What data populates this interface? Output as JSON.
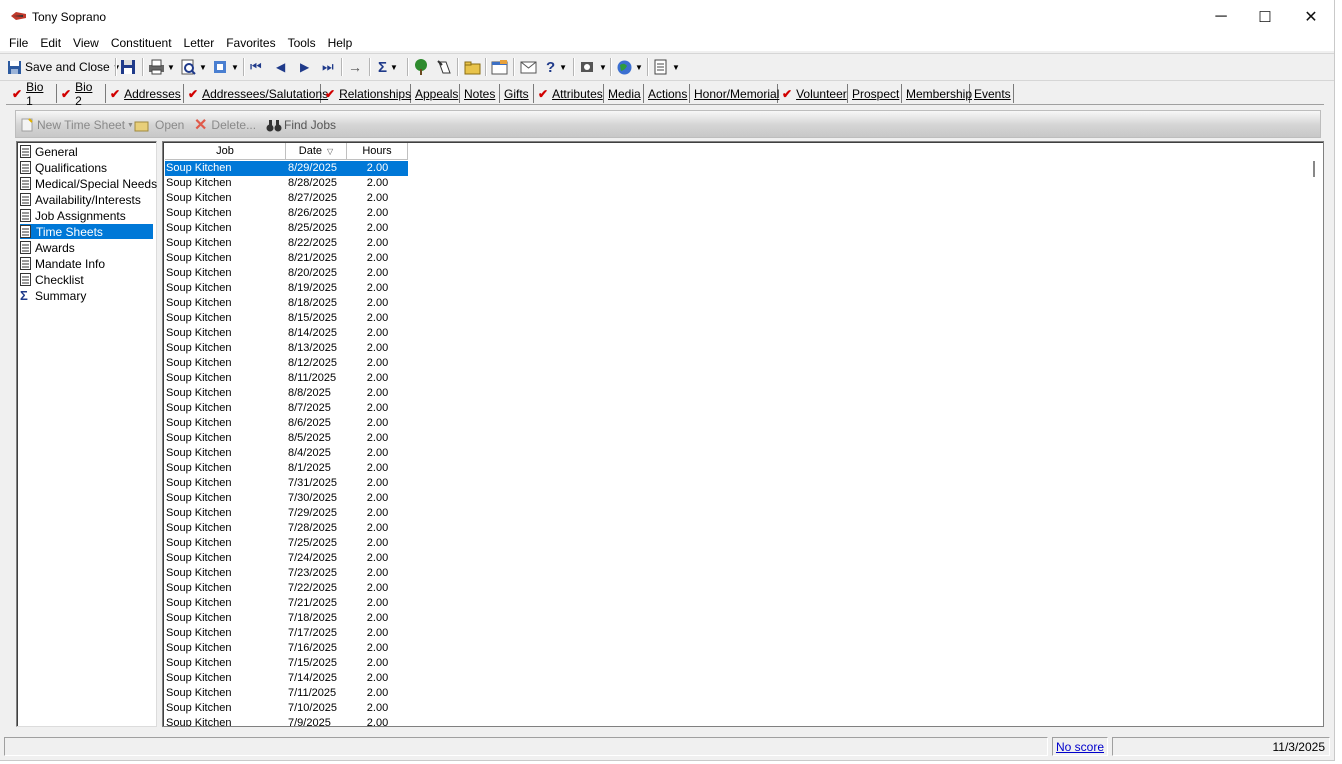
{
  "window": {
    "title": "Tony Soprano",
    "minimize": "─",
    "maximize": "☐",
    "close": "✕"
  },
  "menu": [
    "File",
    "Edit",
    "View",
    "Constituent",
    "Letter",
    "Favorites",
    "Tools",
    "Help"
  ],
  "toolbar": {
    "save_close": "Save and Close"
  },
  "tabs": [
    {
      "label": "Bio 1",
      "checked": true
    },
    {
      "label": "Bio 2",
      "checked": true
    },
    {
      "label": "Addresses",
      "checked": true
    },
    {
      "label": "Addressees/Salutations",
      "checked": true
    },
    {
      "label": "Relationships",
      "checked": true
    },
    {
      "label": "Appeals",
      "checked": false
    },
    {
      "label": "Notes",
      "checked": false
    },
    {
      "label": "Gifts",
      "checked": false
    },
    {
      "label": "Attributes",
      "checked": true
    },
    {
      "label": "Media",
      "checked": false
    },
    {
      "label": "Actions",
      "checked": false
    },
    {
      "label": "Honor/Memorial",
      "checked": false
    },
    {
      "label": "Volunteer",
      "checked": true
    },
    {
      "label": "Prospect",
      "checked": false
    },
    {
      "label": "Membership",
      "checked": false
    },
    {
      "label": "Events",
      "checked": false
    }
  ],
  "action_bar": {
    "new": "New Time Sheet",
    "open": "Open",
    "delete": "Delete...",
    "find": "Find Jobs"
  },
  "nav": [
    {
      "label": "General",
      "icon": "page-icon"
    },
    {
      "label": "Qualifications",
      "icon": "page-icon"
    },
    {
      "label": "Medical/Special Needs",
      "icon": "page-icon"
    },
    {
      "label": "Availability/Interests",
      "icon": "page-icon"
    },
    {
      "label": "Job Assignments",
      "icon": "page-icon"
    },
    {
      "label": "Time Sheets",
      "icon": "page-icon",
      "selected": true
    },
    {
      "label": "Awards",
      "icon": "page-icon"
    },
    {
      "label": "Mandate Info",
      "icon": "page-icon"
    },
    {
      "label": "Checklist",
      "icon": "page-icon"
    },
    {
      "label": "Summary",
      "icon": "sigma-icon"
    }
  ],
  "grid": {
    "columns": [
      "Job",
      "Date",
      "Hours"
    ],
    "rows": [
      [
        "Soup Kitchen",
        "8/29/2025",
        "2.00"
      ],
      [
        "Soup Kitchen",
        "8/28/2025",
        "2.00"
      ],
      [
        "Soup Kitchen",
        "8/27/2025",
        "2.00"
      ],
      [
        "Soup Kitchen",
        "8/26/2025",
        "2.00"
      ],
      [
        "Soup Kitchen",
        "8/25/2025",
        "2.00"
      ],
      [
        "Soup Kitchen",
        "8/22/2025",
        "2.00"
      ],
      [
        "Soup Kitchen",
        "8/21/2025",
        "2.00"
      ],
      [
        "Soup Kitchen",
        "8/20/2025",
        "2.00"
      ],
      [
        "Soup Kitchen",
        "8/19/2025",
        "2.00"
      ],
      [
        "Soup Kitchen",
        "8/18/2025",
        "2.00"
      ],
      [
        "Soup Kitchen",
        "8/15/2025",
        "2.00"
      ],
      [
        "Soup Kitchen",
        "8/14/2025",
        "2.00"
      ],
      [
        "Soup Kitchen",
        "8/13/2025",
        "2.00"
      ],
      [
        "Soup Kitchen",
        "8/12/2025",
        "2.00"
      ],
      [
        "Soup Kitchen",
        "8/11/2025",
        "2.00"
      ],
      [
        "Soup Kitchen",
        "8/8/2025",
        "2.00"
      ],
      [
        "Soup Kitchen",
        "8/7/2025",
        "2.00"
      ],
      [
        "Soup Kitchen",
        "8/6/2025",
        "2.00"
      ],
      [
        "Soup Kitchen",
        "8/5/2025",
        "2.00"
      ],
      [
        "Soup Kitchen",
        "8/4/2025",
        "2.00"
      ],
      [
        "Soup Kitchen",
        "8/1/2025",
        "2.00"
      ],
      [
        "Soup Kitchen",
        "7/31/2025",
        "2.00"
      ],
      [
        "Soup Kitchen",
        "7/30/2025",
        "2.00"
      ],
      [
        "Soup Kitchen",
        "7/29/2025",
        "2.00"
      ],
      [
        "Soup Kitchen",
        "7/28/2025",
        "2.00"
      ],
      [
        "Soup Kitchen",
        "7/25/2025",
        "2.00"
      ],
      [
        "Soup Kitchen",
        "7/24/2025",
        "2.00"
      ],
      [
        "Soup Kitchen",
        "7/23/2025",
        "2.00"
      ],
      [
        "Soup Kitchen",
        "7/22/2025",
        "2.00"
      ],
      [
        "Soup Kitchen",
        "7/21/2025",
        "2.00"
      ],
      [
        "Soup Kitchen",
        "7/18/2025",
        "2.00"
      ],
      [
        "Soup Kitchen",
        "7/17/2025",
        "2.00"
      ],
      [
        "Soup Kitchen",
        "7/16/2025",
        "2.00"
      ],
      [
        "Soup Kitchen",
        "7/15/2025",
        "2.00"
      ],
      [
        "Soup Kitchen",
        "7/14/2025",
        "2.00"
      ],
      [
        "Soup Kitchen",
        "7/11/2025",
        "2.00"
      ],
      [
        "Soup Kitchen",
        "7/10/2025",
        "2.00"
      ],
      [
        "Soup Kitchen",
        "7/9/2025",
        "2.00"
      ]
    ],
    "sort_column": "Date"
  },
  "status": {
    "score_link": "No score",
    "date": "11/3/2025"
  },
  "colors": {
    "selection": "#0078d7",
    "check": "#d10000",
    "toolbar_blue": "#1f3a8a"
  }
}
